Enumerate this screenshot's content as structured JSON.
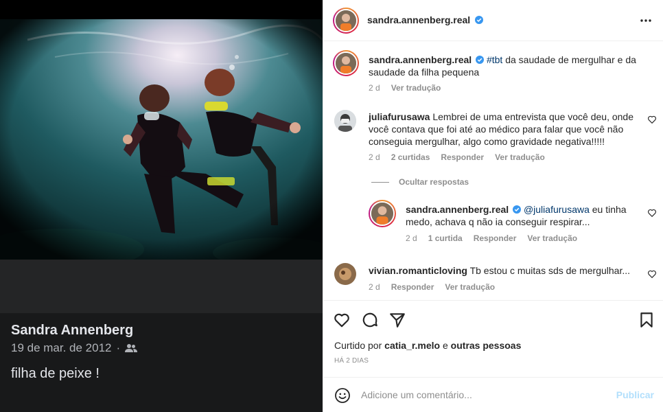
{
  "facebook_card": {
    "name": "Sandra Annenberg",
    "date": "19 de mar. de 2012",
    "separator": "·",
    "text": "filha de peixe !"
  },
  "header": {
    "username": "sandra.annenberg.real",
    "verified": true,
    "more_icon": "more-horizontal-icon"
  },
  "caption": {
    "username": "sandra.annenberg.real",
    "hashtag": "#tbt",
    "text": " da saudade de mergulhar e da saudade da filha pequena",
    "time": "2 d",
    "translate": "Ver tradução"
  },
  "comments": [
    {
      "username": "juliafurusawa",
      "text": "Lembrei de uma entrevista que você deu, onde você contava que foi até ao médico para falar que você não conseguia mergulhar, algo como gravidade negativa!!!!!",
      "time": "2 d",
      "likes": "2 curtidas",
      "reply": "Responder",
      "translate": "Ver tradução"
    },
    {
      "username": "vivian.romanticloving",
      "text": "Tb estou c muitas sds de mergulhar...",
      "time": "2 d",
      "reply": "Responder",
      "translate": "Ver tradução"
    }
  ],
  "hide_replies": "Ocultar respostas",
  "reply": {
    "username": "sandra.annenberg.real",
    "mention": "@juliafurusawa",
    "text": " eu tinha medo, achava q não ia conseguir respirar...",
    "time": "2 d",
    "likes": "1 curtida",
    "reply": "Responder",
    "translate": "Ver tradução"
  },
  "actions": {
    "icons": [
      "heart-icon",
      "comment-icon",
      "share-icon",
      "bookmark-icon"
    ],
    "liked_prefix": "Curtido por ",
    "liked_user": "catia_r.melo",
    "liked_mid": " e ",
    "liked_others": "outras pessoas",
    "time_ago": "HÁ 2 DIAS"
  },
  "add_comment": {
    "placeholder": "Adicione um comentário...",
    "publish": "Publicar"
  },
  "colors": {
    "verified": "#3897f0",
    "link": "#00376b",
    "publish_disabled": "#b2dffc",
    "muted": "#8e8e8e"
  }
}
